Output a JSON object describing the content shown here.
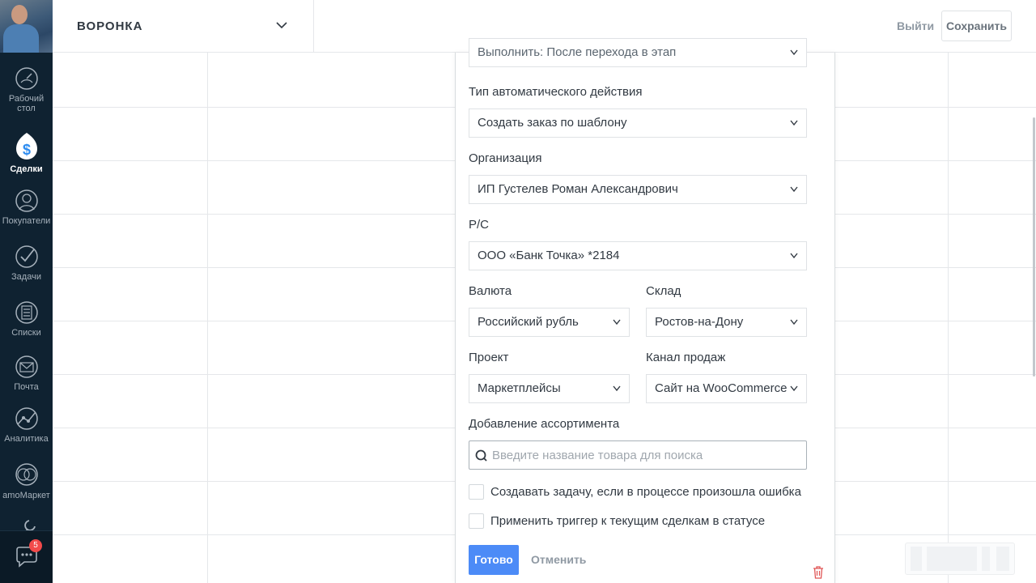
{
  "topbar": {
    "pipeline_title": "ВОРОНКА",
    "exit_label": "Выйти",
    "save_label": "Сохранить"
  },
  "sidebar": {
    "items": [
      {
        "label_line1": "Рабочий",
        "label_line2": "стол",
        "icon": "dashboard-icon"
      },
      {
        "label_line1": "Сделки",
        "label_line2": "",
        "icon": "deals-icon",
        "active": true
      },
      {
        "label_line1": "Покупатели",
        "label_line2": "",
        "icon": "customers-icon"
      },
      {
        "label_line1": "Задачи",
        "label_line2": "",
        "icon": "tasks-icon"
      },
      {
        "label_line1": "Списки",
        "label_line2": "",
        "icon": "lists-icon"
      },
      {
        "label_line1": "Почта",
        "label_line2": "",
        "icon": "mail-icon"
      },
      {
        "label_line1": "Аналитика",
        "label_line2": "",
        "icon": "analytics-icon"
      },
      {
        "label_line1": "amoМаркет",
        "label_line2": "",
        "icon": "market-icon"
      }
    ],
    "chat_badge": "5"
  },
  "form": {
    "top_select_value": "Выполнить: После перехода в этап",
    "action_type_label": "Тип автоматического действия",
    "action_type_value": "Создать заказ по шаблону",
    "organization_label": "Организация",
    "organization_value": "ИП Густелев Роман Александрович",
    "account_label": "Р/С",
    "account_value": "ООО «Банк Точка» *2184",
    "currency_label": "Валюта",
    "currency_value": "Российский рубль",
    "warehouse_label": "Склад",
    "warehouse_value": "Ростов-на-Дону",
    "project_label": "Проект",
    "project_value": "Маркетплейсы",
    "channel_label": "Канал продаж",
    "channel_value": "Сайт на WooCommerce",
    "assortment_label": "Добавление ассортимента",
    "search_placeholder": "Введите название товара для поиска",
    "checkbox_error_task": "Создавать задачу, если в процессе произошла ошибка",
    "checkbox_apply_current": "Применить триггер к текущим сделкам в статусе",
    "done_label": "Готово",
    "cancel_label": "Отменить"
  },
  "colors": {
    "sidebar_bg": "#0f2231",
    "accent_blue": "#4c8bf7",
    "badge_red": "#f24a4a",
    "trash_red": "#e05555"
  }
}
